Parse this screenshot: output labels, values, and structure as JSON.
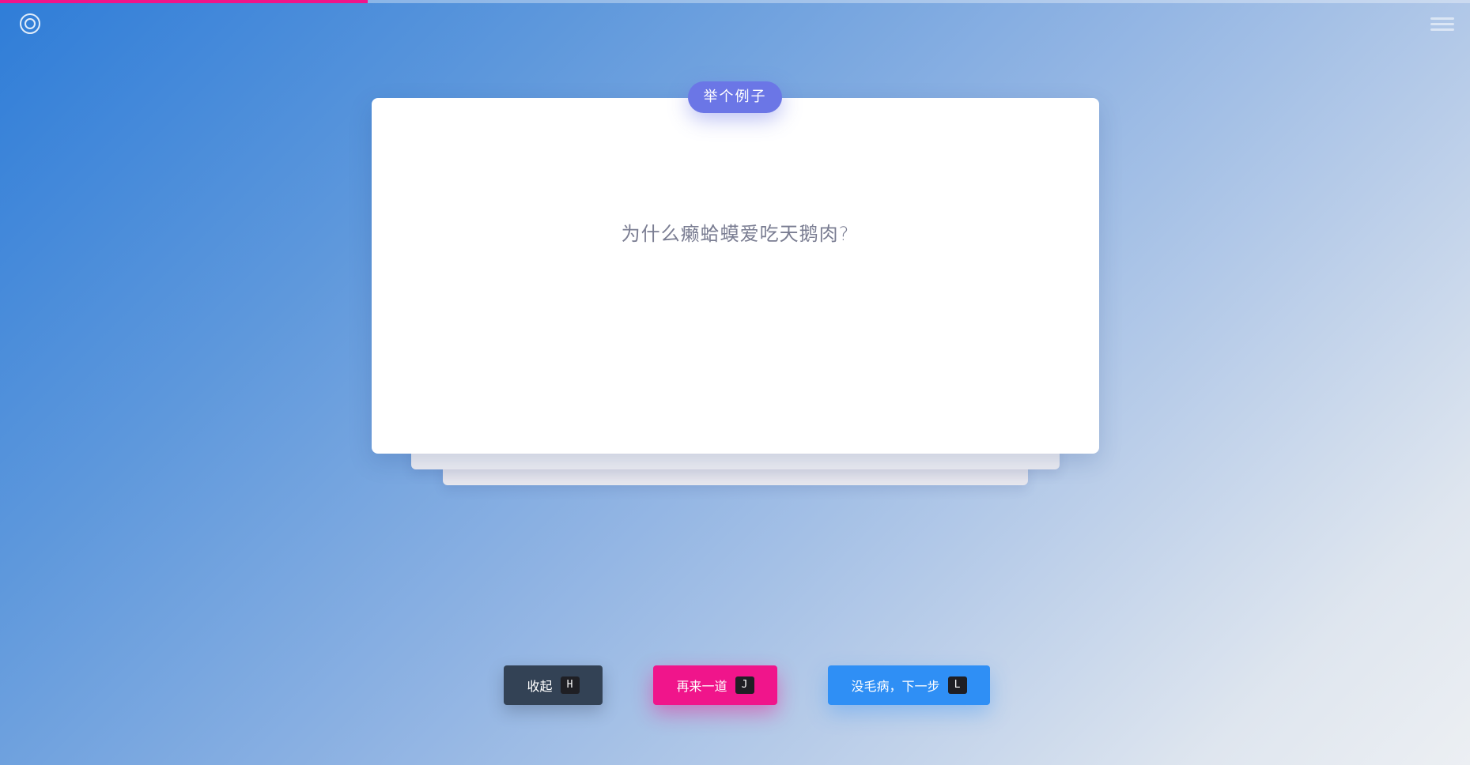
{
  "progress": {
    "value": 0.25,
    "color": "#f0148a"
  },
  "icons": {
    "logo": "target-circle-icon",
    "menu": "hamburger-menu-icon"
  },
  "card": {
    "tag": "举个例子",
    "question": "为什么癞蛤蟆爱吃天鹅肉?"
  },
  "actions": {
    "collapse": {
      "label": "收起",
      "key": "H"
    },
    "again": {
      "label": "再来一道",
      "key": "J"
    },
    "next": {
      "label": "没毛病，下一步",
      "key": "L"
    }
  },
  "colors": {
    "tag": "#6b76e6",
    "collapse": "#334255",
    "again": "#f0158b",
    "next": "#2f8ff5"
  }
}
